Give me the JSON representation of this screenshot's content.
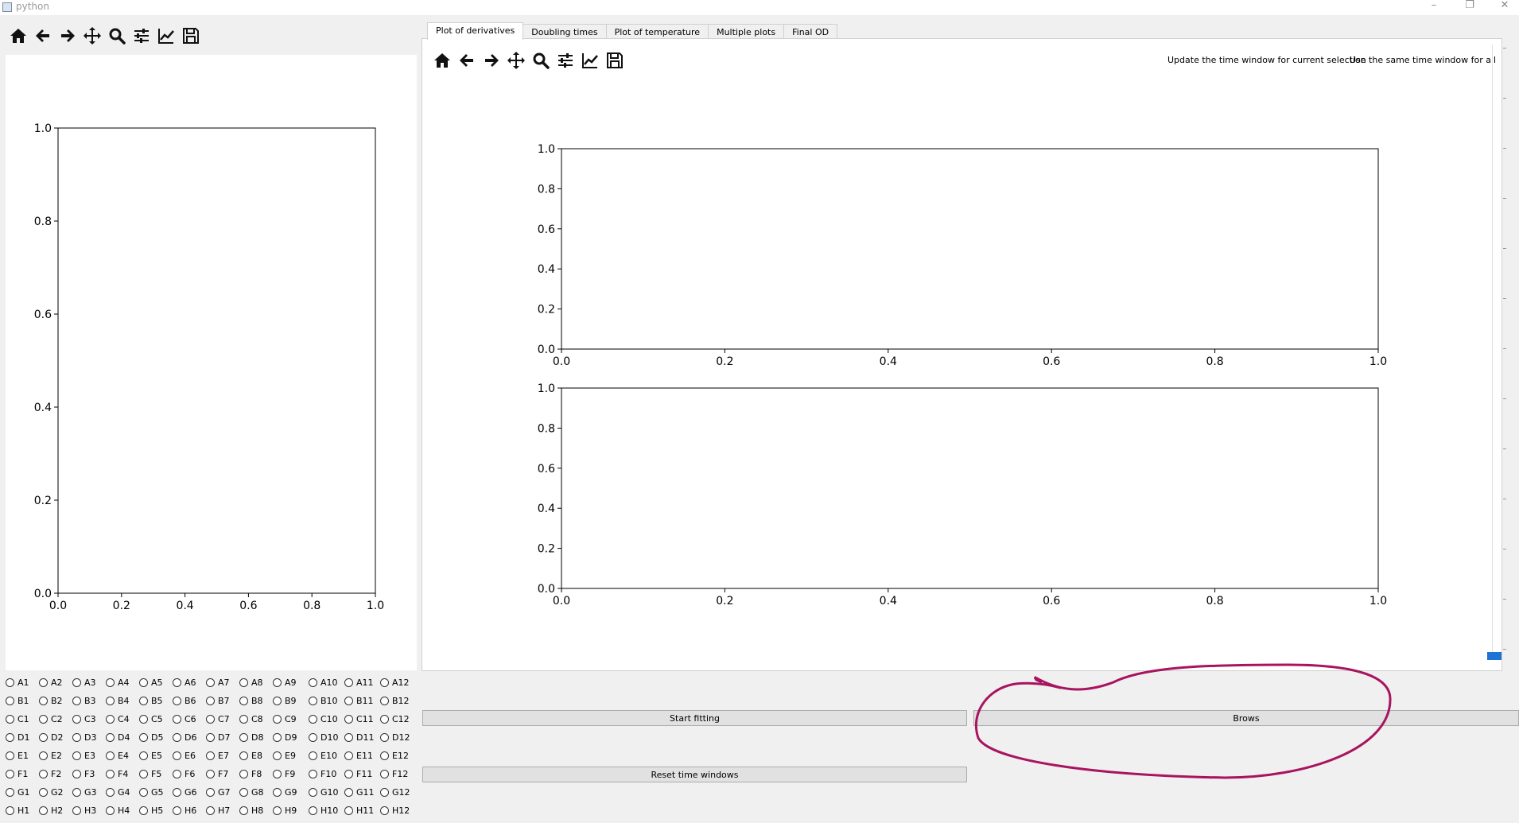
{
  "window": {
    "title": "python",
    "minimize": "–",
    "restore": "❐",
    "close": "✕"
  },
  "left_toolbar": {
    "tools": [
      "home-icon",
      "back-arrow-icon",
      "forward-arrow-icon",
      "pan-icon",
      "zoom-icon",
      "configure-subplots-icon",
      "edit-axis-icon",
      "save-icon"
    ]
  },
  "tabs": [
    "Plot of derivatives",
    "Doubling times",
    "Plot of temperature",
    "Multiple plots",
    "Final OD"
  ],
  "active_tab": 0,
  "right_toolbar": {
    "tools": [
      "home-icon",
      "back-arrow-icon",
      "forward-arrow-icon",
      "pan-icon",
      "zoom-icon",
      "configure-subplots-icon",
      "edit-axis-icon",
      "save-icon"
    ]
  },
  "actions": {
    "update_window": "Update the time window for current selection",
    "same_window": "Use the same time window for all",
    "start_fitting": "Start fitting",
    "browse": "Brows",
    "reset_windows": "Reset time windows"
  },
  "colors": {
    "annotation": "#a8145f",
    "handle": "#1e73d6"
  },
  "wells": {
    "rows": [
      "A",
      "B",
      "C",
      "D",
      "E",
      "F",
      "G",
      "H"
    ],
    "cols": [
      "1",
      "2",
      "3",
      "4",
      "5",
      "6",
      "7",
      "8",
      "9",
      "10",
      "11",
      "12"
    ]
  },
  "chart_data": [
    {
      "type": "line",
      "title": "",
      "xlabel": "",
      "ylabel": "",
      "xlim": [
        0,
        1
      ],
      "ylim": [
        0,
        1
      ],
      "xticks": [
        "0.0",
        "0.2",
        "0.4",
        "0.6",
        "0.8",
        "1.0"
      ],
      "yticks": [
        "0.0",
        "0.2",
        "0.4",
        "0.6",
        "0.8",
        "1.0"
      ],
      "series": []
    },
    {
      "type": "line",
      "title": "",
      "xlabel": "",
      "ylabel": "",
      "xlim": [
        0,
        1
      ],
      "ylim": [
        0,
        1
      ],
      "xticks": [
        "0.0",
        "0.2",
        "0.4",
        "0.6",
        "0.8",
        "1.0"
      ],
      "yticks": [
        "0.0",
        "0.2",
        "0.4",
        "0.6",
        "0.8",
        "1.0"
      ],
      "series": []
    },
    {
      "type": "line",
      "title": "",
      "xlabel": "",
      "ylabel": "",
      "xlim": [
        0,
        1
      ],
      "ylim": [
        0,
        1
      ],
      "xticks": [
        "0.0",
        "0.2",
        "0.4",
        "0.6",
        "0.8",
        "1.0"
      ],
      "yticks": [
        "0.0",
        "0.2",
        "0.4",
        "0.6",
        "0.8",
        "1.0"
      ],
      "series": []
    }
  ]
}
